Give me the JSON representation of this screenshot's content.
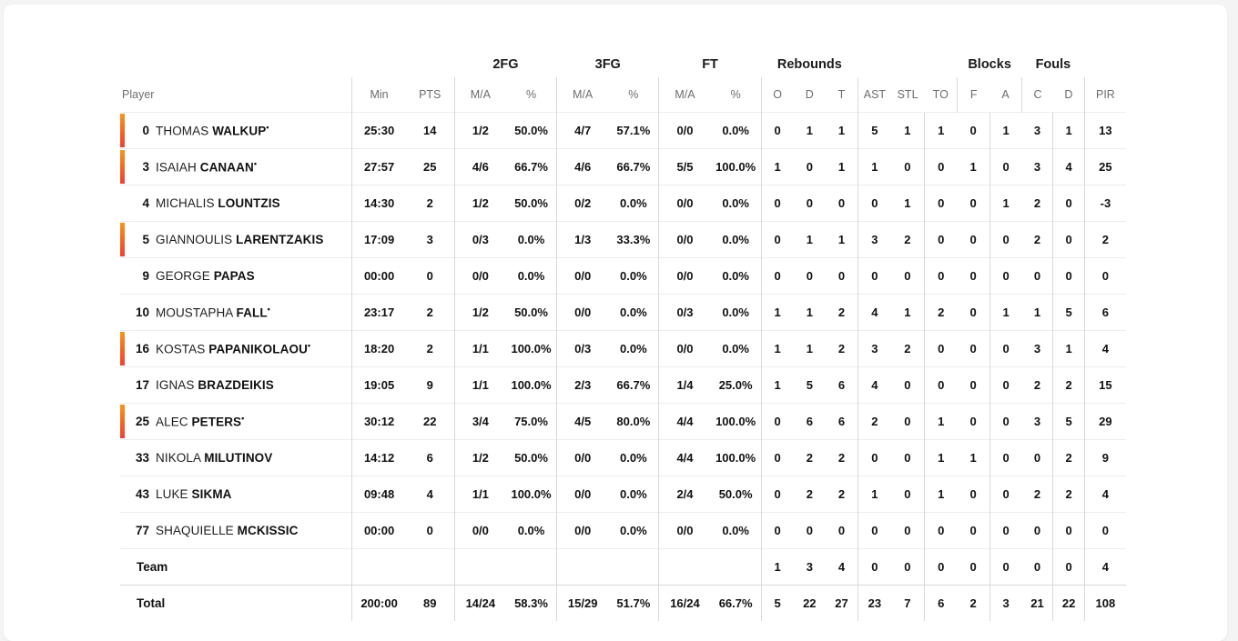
{
  "table": {
    "group_headers": [
      {
        "label": "",
        "span": 1
      },
      {
        "label": "",
        "span": 2
      },
      {
        "label": "2FG",
        "span": 2
      },
      {
        "label": "3FG",
        "span": 2
      },
      {
        "label": "FT",
        "span": 2
      },
      {
        "label": "Rebounds",
        "span": 3
      },
      {
        "label": "",
        "span": 3
      },
      {
        "label": "Blocks",
        "span": 2
      },
      {
        "label": "Fouls",
        "span": 2
      },
      {
        "label": "",
        "span": 1
      }
    ],
    "columns": [
      "Player",
      "Min",
      "PTS",
      "M/A",
      "%",
      "M/A",
      "%",
      "M/A",
      "%",
      "O",
      "D",
      "T",
      "AST",
      "STL",
      "TO",
      "F",
      "A",
      "C",
      "D",
      "PIR"
    ],
    "rows": [
      {
        "starter": true,
        "number": "0",
        "first": "THOMAS",
        "last": "WALKUP",
        "star": true,
        "cells": [
          "25:30",
          "14",
          "1/2",
          "50.0%",
          "4/7",
          "57.1%",
          "0/0",
          "0.0%",
          "0",
          "1",
          "1",
          "5",
          "1",
          "1",
          "0",
          "1",
          "3",
          "1",
          "13"
        ]
      },
      {
        "starter": true,
        "number": "3",
        "first": "ISAIAH",
        "last": "CANAAN",
        "star": true,
        "cells": [
          "27:57",
          "25",
          "4/6",
          "66.7%",
          "4/6",
          "66.7%",
          "5/5",
          "100.0%",
          "1",
          "0",
          "1",
          "1",
          "0",
          "0",
          "1",
          "0",
          "3",
          "4",
          "25"
        ]
      },
      {
        "starter": false,
        "number": "4",
        "first": "MICHALIS",
        "last": "LOUNTZIS",
        "star": false,
        "cells": [
          "14:30",
          "2",
          "1/2",
          "50.0%",
          "0/2",
          "0.0%",
          "0/0",
          "0.0%",
          "0",
          "0",
          "0",
          "0",
          "1",
          "0",
          "0",
          "1",
          "2",
          "0",
          "-3"
        ]
      },
      {
        "starter": true,
        "number": "5",
        "first": "GIANNOULIS",
        "last": "LARENTZAKIS",
        "star": false,
        "cells": [
          "17:09",
          "3",
          "0/3",
          "0.0%",
          "1/3",
          "33.3%",
          "0/0",
          "0.0%",
          "0",
          "1",
          "1",
          "3",
          "2",
          "0",
          "0",
          "0",
          "2",
          "0",
          "2"
        ]
      },
      {
        "starter": false,
        "number": "9",
        "first": "GEORGE",
        "last": "PAPAS",
        "star": false,
        "cells": [
          "00:00",
          "0",
          "0/0",
          "0.0%",
          "0/0",
          "0.0%",
          "0/0",
          "0.0%",
          "0",
          "0",
          "0",
          "0",
          "0",
          "0",
          "0",
          "0",
          "0",
          "0",
          "0"
        ]
      },
      {
        "starter": false,
        "number": "10",
        "first": "MOUSTAPHA",
        "last": "FALL",
        "star": true,
        "cells": [
          "23:17",
          "2",
          "1/2",
          "50.0%",
          "0/0",
          "0.0%",
          "0/3",
          "0.0%",
          "1",
          "1",
          "2",
          "4",
          "1",
          "2",
          "0",
          "1",
          "1",
          "5",
          "6"
        ]
      },
      {
        "starter": true,
        "number": "16",
        "first": "KOSTAS",
        "last": "PAPANIKOLAOU",
        "star": true,
        "cells": [
          "18:20",
          "2",
          "1/1",
          "100.0%",
          "0/3",
          "0.0%",
          "0/0",
          "0.0%",
          "1",
          "1",
          "2",
          "3",
          "2",
          "0",
          "0",
          "0",
          "3",
          "1",
          "4"
        ]
      },
      {
        "starter": false,
        "number": "17",
        "first": "IGNAS",
        "last": "BRAZDEIKIS",
        "star": false,
        "cells": [
          "19:05",
          "9",
          "1/1",
          "100.0%",
          "2/3",
          "66.7%",
          "1/4",
          "25.0%",
          "1",
          "5",
          "6",
          "4",
          "0",
          "0",
          "0",
          "0",
          "2",
          "2",
          "15"
        ]
      },
      {
        "starter": true,
        "number": "25",
        "first": "ALEC",
        "last": "PETERS",
        "star": true,
        "cells": [
          "30:12",
          "22",
          "3/4",
          "75.0%",
          "4/5",
          "80.0%",
          "4/4",
          "100.0%",
          "0",
          "6",
          "6",
          "2",
          "0",
          "1",
          "0",
          "0",
          "3",
          "5",
          "29"
        ]
      },
      {
        "starter": false,
        "number": "33",
        "first": "NIKOLA",
        "last": "MILUTINOV",
        "star": false,
        "cells": [
          "14:12",
          "6",
          "1/2",
          "50.0%",
          "0/0",
          "0.0%",
          "4/4",
          "100.0%",
          "0",
          "2",
          "2",
          "0",
          "0",
          "1",
          "1",
          "0",
          "0",
          "2",
          "9"
        ]
      },
      {
        "starter": false,
        "number": "43",
        "first": "LUKE",
        "last": "SIKMA",
        "star": false,
        "cells": [
          "09:48",
          "4",
          "1/1",
          "100.0%",
          "0/0",
          "0.0%",
          "2/4",
          "50.0%",
          "0",
          "2",
          "2",
          "1",
          "0",
          "1",
          "0",
          "0",
          "2",
          "2",
          "4"
        ]
      },
      {
        "starter": false,
        "number": "77",
        "first": "SHAQUIELLE",
        "last": "MCKISSIC",
        "star": false,
        "cells": [
          "00:00",
          "0",
          "0/0",
          "0.0%",
          "0/0",
          "0.0%",
          "0/0",
          "0.0%",
          "0",
          "0",
          "0",
          "0",
          "0",
          "0",
          "0",
          "0",
          "0",
          "0",
          "0"
        ]
      }
    ],
    "team_row": {
      "label": "Team",
      "cells": [
        "",
        "",
        "",
        "",
        "",
        "",
        "",
        "",
        "1",
        "3",
        "4",
        "0",
        "0",
        "0",
        "0",
        "0",
        "0",
        "0",
        "4"
      ]
    },
    "total_row": {
      "label": "Total",
      "cells": [
        "200:00",
        "89",
        "14/24",
        "58.3%",
        "15/29",
        "51.7%",
        "16/24",
        "66.7%",
        "5",
        "22",
        "27",
        "23",
        "7",
        "6",
        "2",
        "3",
        "21",
        "22",
        "108"
      ]
    },
    "accent_color": "#f26522",
    "accent_gradient_start": "#f7941e",
    "accent_gradient_end": "#ef4136"
  }
}
